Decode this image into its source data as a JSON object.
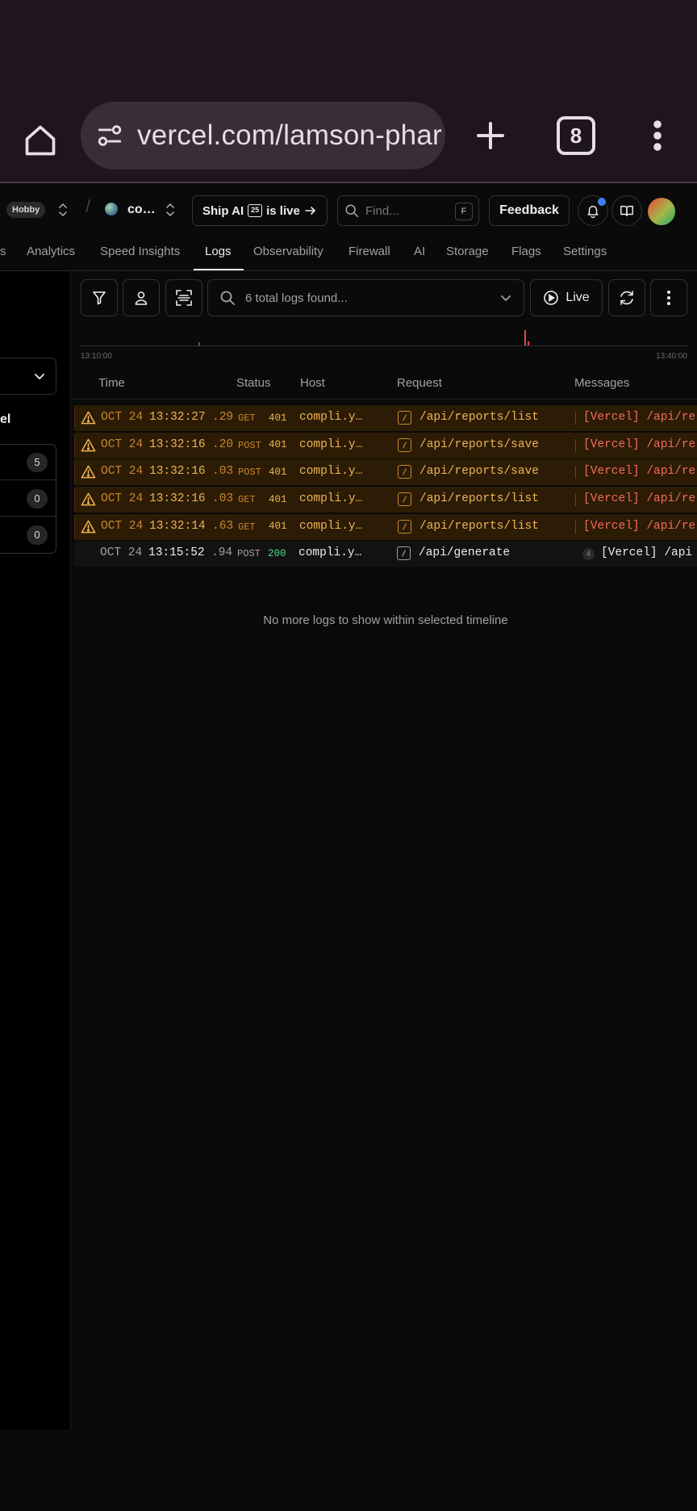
{
  "browser": {
    "url": "vercel.com/lamson-phar",
    "tab_count": "8"
  },
  "header": {
    "plan_badge": "Hobby",
    "project_name": "co…",
    "ship_ai": {
      "prefix": "Ship AI",
      "badge": "25",
      "suffix": "is live"
    },
    "find_placeholder": "Find...",
    "find_shortcut": "F",
    "feedback_label": "Feedback"
  },
  "nav": {
    "tabs": [
      {
        "label": "s"
      },
      {
        "label": "Analytics"
      },
      {
        "label": "Speed Insights"
      },
      {
        "label": "Logs",
        "active": true
      },
      {
        "label": "Observability"
      },
      {
        "label": "Firewall"
      },
      {
        "label": "AI"
      },
      {
        "label": "Storage"
      },
      {
        "label": "Flags"
      },
      {
        "label": "Settings"
      }
    ]
  },
  "sidebar": {
    "section_label": "el",
    "counts": [
      "5",
      "0",
      "0"
    ]
  },
  "toolbar": {
    "search_placeholder": "6 total logs found...",
    "live_label": "Live"
  },
  "timeline": {
    "start": "13:10:00",
    "end": "13:40:00"
  },
  "table": {
    "columns": [
      "Time",
      "Status",
      "Host",
      "Request",
      "Messages"
    ],
    "rows": [
      {
        "level": "warning",
        "date": "OCT 24",
        "time": "13:32:27",
        "ms": ".29",
        "method": "GET",
        "status": "401",
        "host": "compli.y…",
        "request": "/api/reports/list",
        "message": "[Vercel] /api/re"
      },
      {
        "level": "warning",
        "date": "OCT 24",
        "time": "13:32:16",
        "ms": ".20",
        "method": "POST",
        "status": "401",
        "host": "compli.y…",
        "request": "/api/reports/save",
        "message": "[Vercel] /api/re"
      },
      {
        "level": "warning",
        "date": "OCT 24",
        "time": "13:32:16",
        "ms": ".03",
        "method": "POST",
        "status": "401",
        "host": "compli.y…",
        "request": "/api/reports/save",
        "message": "[Vercel] /api/re"
      },
      {
        "level": "warning",
        "date": "OCT 24",
        "time": "13:32:16",
        "ms": ".03",
        "method": "GET",
        "status": "401",
        "host": "compli.y…",
        "request": "/api/reports/list",
        "message": "[Vercel] /api/re"
      },
      {
        "level": "warning",
        "date": "OCT 24",
        "time": "13:32:14",
        "ms": ".63",
        "method": "GET",
        "status": "401",
        "host": "compli.y…",
        "request": "/api/reports/list",
        "message": "[Vercel] /api/re"
      },
      {
        "level": "info",
        "date": "OCT 24",
        "time": "13:15:52",
        "ms": ".94",
        "method": "POST",
        "status": "200",
        "host": "compli.y…",
        "request": "/api/generate",
        "message_count": "4",
        "message": "[Vercel] /api"
      }
    ],
    "end_message": "No more logs to show within selected timeline"
  },
  "colors": {
    "warning_row_bg": "#2c1c06",
    "warning_text": "#f0b455",
    "error_message": "#f26d5a",
    "success_status": "#4ade80",
    "notification_dot": "#3b82f6"
  },
  "icons": [
    "home-icon",
    "site-settings-icon",
    "plus-icon",
    "more-vert-icon",
    "chevron-updown-icon",
    "arrow-right-icon",
    "search-icon",
    "bell-icon",
    "book-icon",
    "filter-icon",
    "user-icon",
    "scan-icon",
    "chevron-down-icon",
    "play-circle-icon",
    "refresh-icon",
    "more-vert-icon",
    "warning-icon",
    "function-icon"
  ]
}
